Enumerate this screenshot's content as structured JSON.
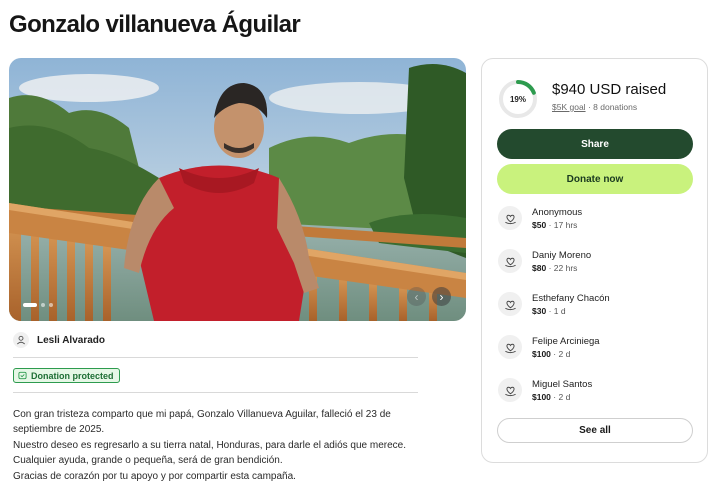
{
  "page": {
    "title": "Gonzalo villanueva Águilar"
  },
  "photo": {
    "alt": "",
    "slide_count": 3,
    "active_slide": 1
  },
  "organizer": {
    "name": "Lesli Alvarado"
  },
  "badge": {
    "label": "Donation protected"
  },
  "story": {
    "lines": [
      "Con gran tristeza comparto que mi papá, Gonzalo Villanueva Aguilar, falleció el 23 de",
      "septiembre de 2025.",
      "Nuestro deseo es regresarlo a su tierra natal, Honduras, para darle el adiós que merece.",
      "Cualquier ayuda, grande o pequeña, será de gran bendición.",
      "Gracias de corazón por tu apoyo y por compartir esta campaña."
    ]
  },
  "fundraiser": {
    "progress_percent": 19,
    "progress_label": "19%",
    "raised": "$940 USD raised",
    "goal": "$5K goal",
    "separator": "·",
    "donations": "8 donations",
    "share_label": "Share",
    "donate_label": "Donate now",
    "see_all_label": "See all",
    "accent_color": "#2d9b4e",
    "donate_color": "#c9f27d",
    "share_color": "#234a2e"
  },
  "donors": [
    {
      "name": "Anonymous",
      "amount": "$50",
      "time": "17 hrs"
    },
    {
      "name": "Daniy Moreno",
      "amount": "$80",
      "time": "22 hrs"
    },
    {
      "name": "Esthefany Chacón",
      "amount": "$30",
      "time": "1 d"
    },
    {
      "name": "Felipe Arciniega",
      "amount": "$100",
      "time": "2 d"
    },
    {
      "name": "Miguel Santos",
      "amount": "$100",
      "time": "2 d"
    }
  ],
  "icons": {
    "organizer": "person-icon",
    "badge": "shield-icon",
    "donor": "heart-hand-icon",
    "prev": "arrow-left-icon",
    "next": "arrow-right-icon"
  }
}
